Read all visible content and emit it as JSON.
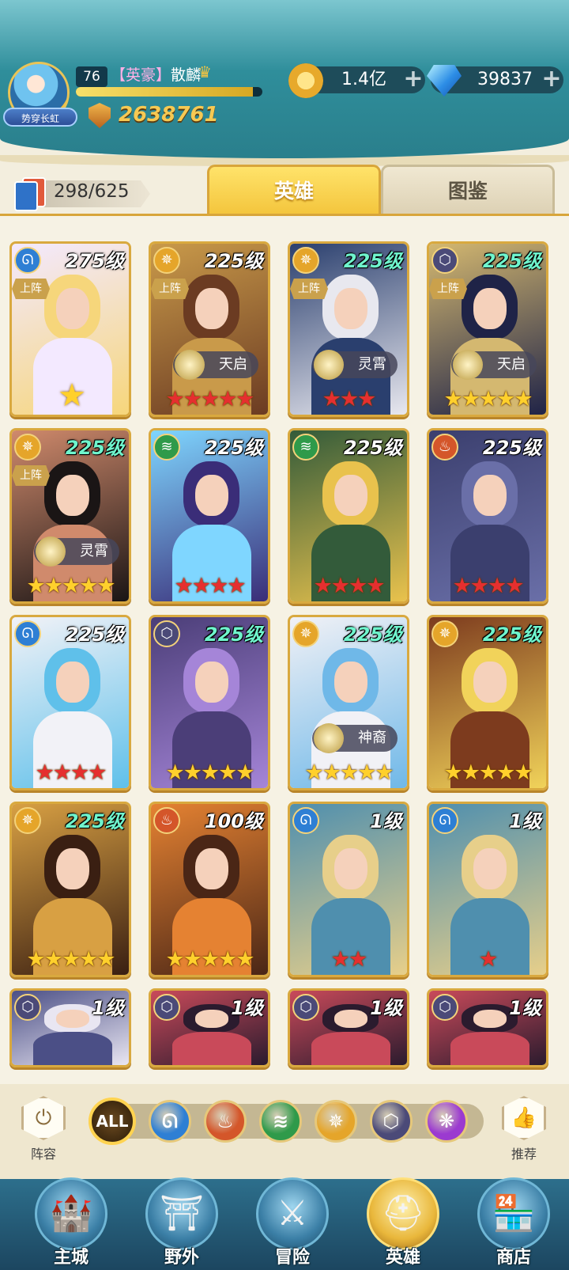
{
  "header": {
    "player_level": "76",
    "title_tag": "【英豪】",
    "player_name": "散麟",
    "avatar_tag": "势穿长虹",
    "power": "2638761",
    "xp_fraction": 0.95,
    "gold": "1.4亿",
    "gems": "39837"
  },
  "roster": {
    "count": "298/625",
    "tabs": [
      {
        "label": "英雄",
        "active": true
      },
      {
        "label": "图鉴",
        "active": false
      }
    ]
  },
  "heroes": [
    {
      "level": "275级",
      "cyan": false,
      "element": "water",
      "lineup": "上阵",
      "faction": "",
      "stars": 0,
      "star_color": "gold",
      "medal": true,
      "palette": [
        "#f6d67b",
        "#f3e9ff"
      ]
    },
    {
      "level": "225级",
      "cyan": false,
      "element": "light",
      "lineup": "上阵",
      "faction": "天启",
      "stars": 5,
      "star_color": "red",
      "medal": false,
      "palette": [
        "#6b3b22",
        "#c99a4a"
      ]
    },
    {
      "level": "225级",
      "cyan": true,
      "element": "light",
      "lineup": "上阵",
      "faction": "灵霄",
      "stars": 3,
      "star_color": "red",
      "medal": false,
      "palette": [
        "#e8e8ef",
        "#2a3f6e"
      ]
    },
    {
      "level": "225级",
      "cyan": true,
      "element": "dark",
      "lineup": "上阵",
      "faction": "天启",
      "stars": 5,
      "star_color": "gold",
      "medal": false,
      "palette": [
        "#1f2347",
        "#d4b870"
      ]
    },
    {
      "level": "225级",
      "cyan": true,
      "element": "light",
      "lineup": "上阵",
      "faction": "灵霄",
      "stars": 5,
      "star_color": "gold",
      "medal": false,
      "palette": [
        "#1a1515",
        "#d08a6c"
      ]
    },
    {
      "level": "225级",
      "cyan": false,
      "element": "wind",
      "lineup": "",
      "faction": "",
      "stars": 4,
      "star_color": "red",
      "medal": false,
      "palette": [
        "#3a2d78",
        "#7fd6ff"
      ]
    },
    {
      "level": "225级",
      "cyan": false,
      "element": "wind",
      "lineup": "",
      "faction": "",
      "stars": 4,
      "star_color": "red",
      "medal": false,
      "palette": [
        "#e9c24d",
        "#335b3a"
      ]
    },
    {
      "level": "225级",
      "cyan": false,
      "element": "fire",
      "lineup": "",
      "faction": "",
      "stars": 4,
      "star_color": "red",
      "medal": false,
      "palette": [
        "#6a6fa8",
        "#3b3f6e"
      ]
    },
    {
      "level": "225级",
      "cyan": false,
      "element": "water",
      "lineup": "",
      "faction": "",
      "stars": 4,
      "star_color": "red",
      "medal": false,
      "palette": [
        "#5fc0ea",
        "#f2f2f7"
      ]
    },
    {
      "level": "225级",
      "cyan": true,
      "element": "dark",
      "lineup": "",
      "faction": "",
      "stars": 5,
      "star_color": "gold",
      "medal": false,
      "palette": [
        "#a585d8",
        "#4b3e78"
      ]
    },
    {
      "level": "225级",
      "cyan": true,
      "element": "light",
      "lineup": "",
      "faction": "神裔",
      "stars": 5,
      "star_color": "gold",
      "medal": false,
      "palette": [
        "#6fb8e8",
        "#f1f1f6"
      ]
    },
    {
      "level": "225级",
      "cyan": true,
      "element": "light",
      "lineup": "",
      "faction": "",
      "stars": 5,
      "star_color": "gold",
      "medal": false,
      "palette": [
        "#f1d35a",
        "#7d3b1e"
      ]
    },
    {
      "level": "225级",
      "cyan": true,
      "element": "light",
      "lineup": "",
      "faction": "",
      "stars": 5,
      "star_color": "gold",
      "medal": false,
      "palette": [
        "#3a1f12",
        "#d8a043"
      ]
    },
    {
      "level": "100级",
      "cyan": false,
      "element": "fire",
      "lineup": "",
      "faction": "",
      "stars": 5,
      "star_color": "gold",
      "medal": false,
      "palette": [
        "#4a2616",
        "#e58232"
      ]
    },
    {
      "level": "1级",
      "cyan": false,
      "element": "water",
      "lineup": "",
      "faction": "",
      "stars": 2,
      "star_color": "red",
      "medal": false,
      "palette": [
        "#e7cf8a",
        "#4f8fae"
      ]
    },
    {
      "level": "1级",
      "cyan": false,
      "element": "water",
      "lineup": "",
      "faction": "",
      "stars": 1,
      "star_color": "red",
      "medal": false,
      "palette": [
        "#e7cf8a",
        "#4f8fae"
      ]
    },
    {
      "level": "1级",
      "cyan": false,
      "element": "dark",
      "lineup": "",
      "faction": "",
      "stars": 0,
      "star_color": "red",
      "medal": false,
      "palette": [
        "#e9e6f2",
        "#4b4f86"
      ]
    },
    {
      "level": "1级",
      "cyan": false,
      "element": "dark",
      "lineup": "",
      "faction": "",
      "stars": 0,
      "star_color": "red",
      "medal": false,
      "palette": [
        "#2b1b2e",
        "#c94a5a"
      ]
    },
    {
      "level": "1级",
      "cyan": false,
      "element": "dark",
      "lineup": "",
      "faction": "",
      "stars": 0,
      "star_color": "red",
      "medal": false,
      "palette": [
        "#2b1b2e",
        "#c94a5a"
      ]
    },
    {
      "level": "1级",
      "cyan": false,
      "element": "dark",
      "lineup": "",
      "faction": "",
      "stars": 0,
      "star_color": "red",
      "medal": false,
      "palette": [
        "#2b1b2e",
        "#c94a5a"
      ]
    }
  ],
  "element_colors": {
    "water": "#2e7fd4",
    "light": "#e5a52a",
    "dark": "#4b4a78",
    "wind": "#2f9a4a",
    "fire": "#d4562a",
    "chaos": "#9b3ad0"
  },
  "filters": {
    "left_label": "阵容",
    "right_label": "推荐",
    "all_label": "ALL",
    "orbs": [
      "water",
      "fire",
      "wind",
      "light",
      "dark",
      "chaos"
    ]
  },
  "nav": [
    {
      "label": "主城",
      "icon": "castle-icon",
      "active": false
    },
    {
      "label": "野外",
      "icon": "portal-icon",
      "active": false
    },
    {
      "label": "冒险",
      "icon": "sword-icon",
      "active": false
    },
    {
      "label": "英雄",
      "icon": "helmet-icon",
      "active": true
    },
    {
      "label": "商店",
      "icon": "shop-icon",
      "active": false
    }
  ]
}
